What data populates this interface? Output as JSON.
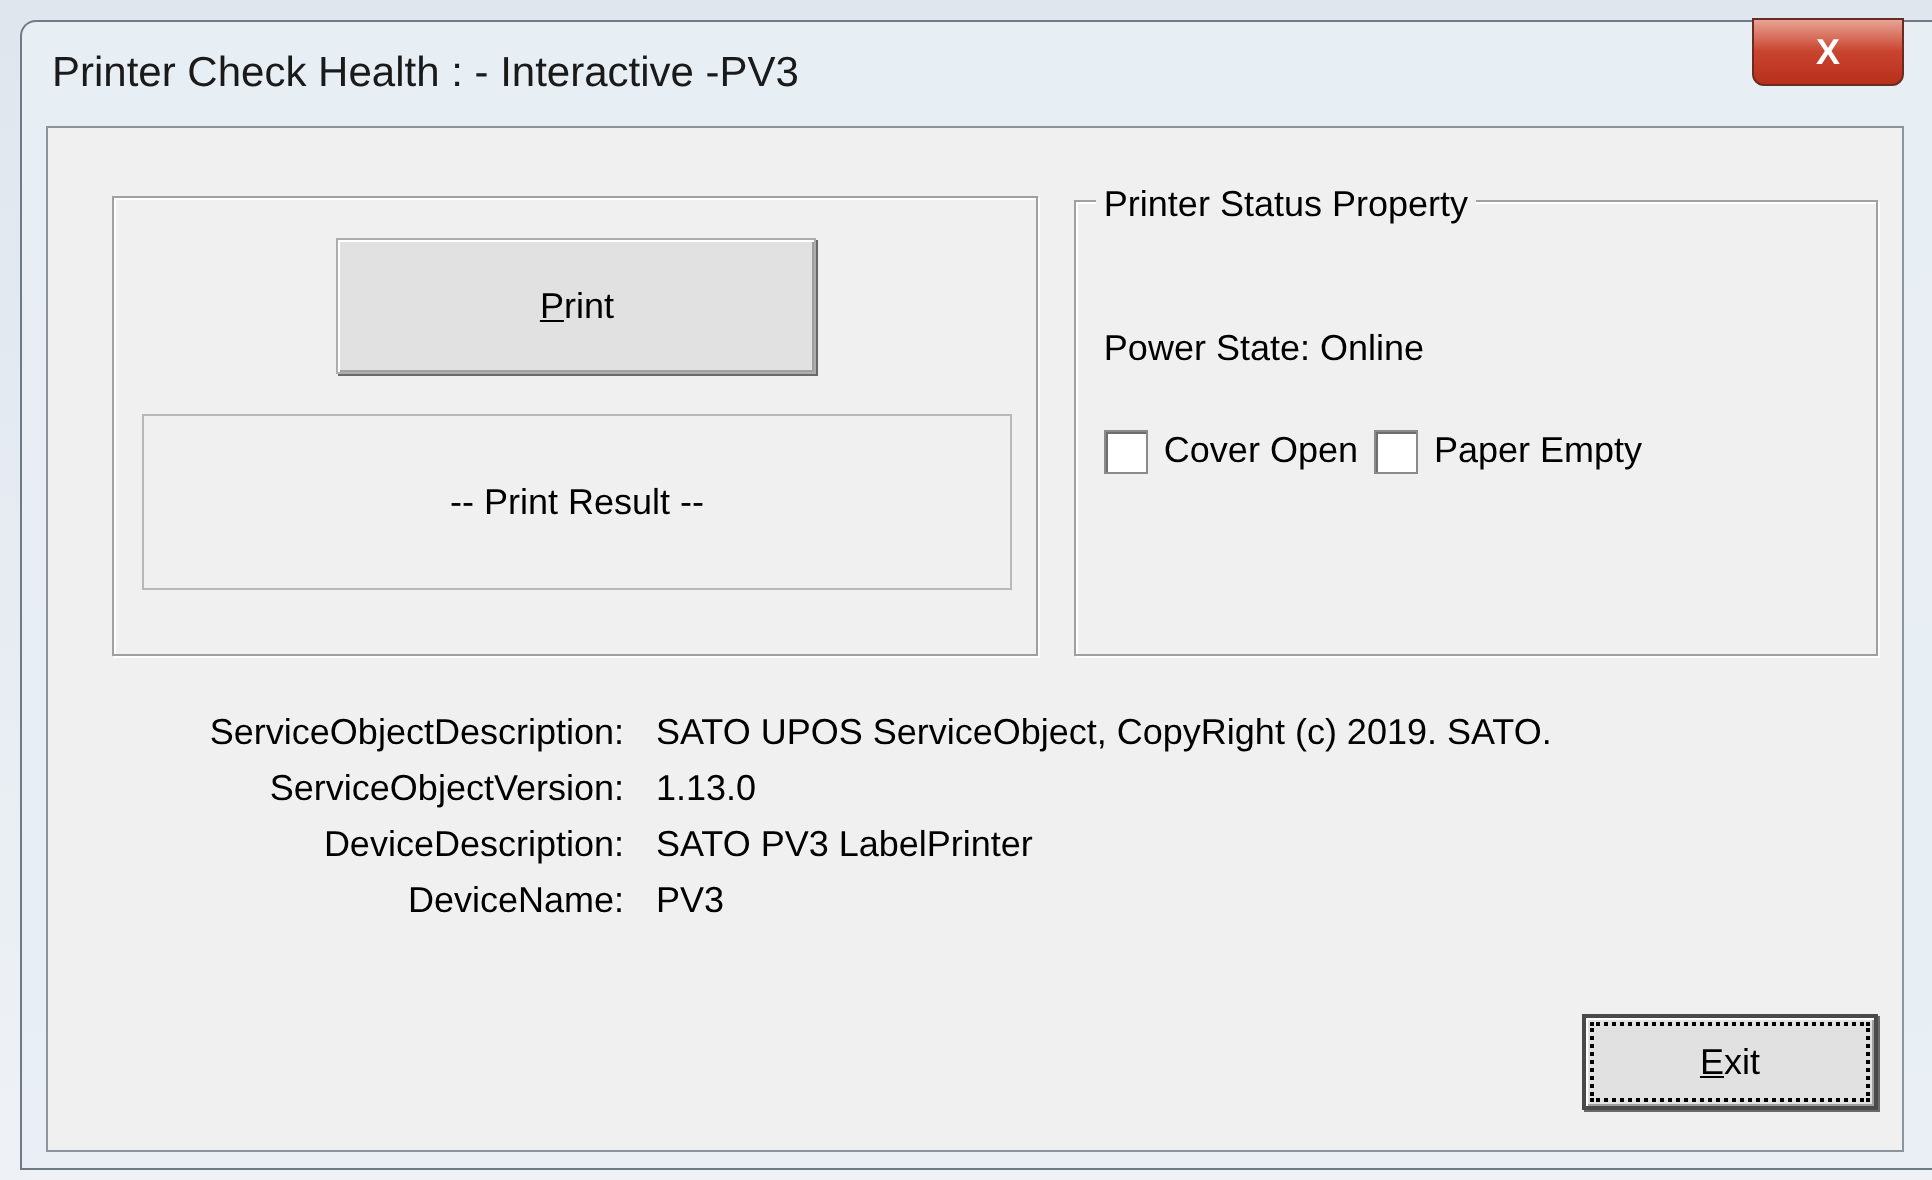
{
  "window": {
    "title": "Printer Check Health : - Interactive -PV3",
    "close_label": "X"
  },
  "print_button": {
    "label": "Print",
    "underline_first": true,
    "focused": false
  },
  "print_result": "-- Print Result --",
  "status_group": {
    "title": "Printer Status Property",
    "power_state": "Power State: Online",
    "checkboxes": [
      {
        "label": "Cover Open",
        "checked": false
      },
      {
        "label": "Paper Empty",
        "checked": false
      }
    ]
  },
  "info": [
    {
      "label": "ServiceObjectDescription:",
      "value": "SATO UPOS ServiceObject, CopyRight (c) 2019. SATO."
    },
    {
      "label": "ServiceObjectVersion:",
      "value": "1.13.0"
    },
    {
      "label": "DeviceDescription:",
      "value": "SATO PV3 LabelPrinter"
    },
    {
      "label": "DeviceName:",
      "value": "PV3"
    }
  ],
  "exit_button": {
    "label": "Exit",
    "underline_first": true,
    "focused": true
  }
}
